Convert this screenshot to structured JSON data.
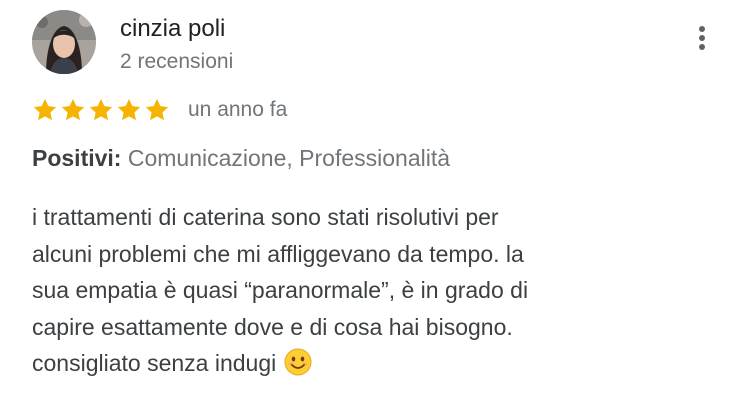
{
  "review": {
    "author_name": "cinzia poli",
    "author_meta": "2 recensioni",
    "rating": 5,
    "rating_max": 5,
    "date": "un anno fa",
    "positives_label": "Positivi:",
    "positives_value": "Comunicazione, Professionalità",
    "text_lines": [
      "i trattamenti di caterina sono stati risolutivi per",
      "alcuni problemi che mi affliggevano da tempo. la",
      "sua empatia è quasi “paranormale”, è in grado di",
      "capire esattamente dove e di cosa hai bisogno.",
      "consigliato senza indugi"
    ],
    "emoji": "smiling-face-emoji"
  },
  "colors": {
    "star": "#f4b400",
    "muted_text": "#70757a",
    "body_text": "#3c4043",
    "menu_dots": "#5f6368"
  },
  "icons": {
    "menu": "more-vertical-icon",
    "star": "star-icon"
  }
}
